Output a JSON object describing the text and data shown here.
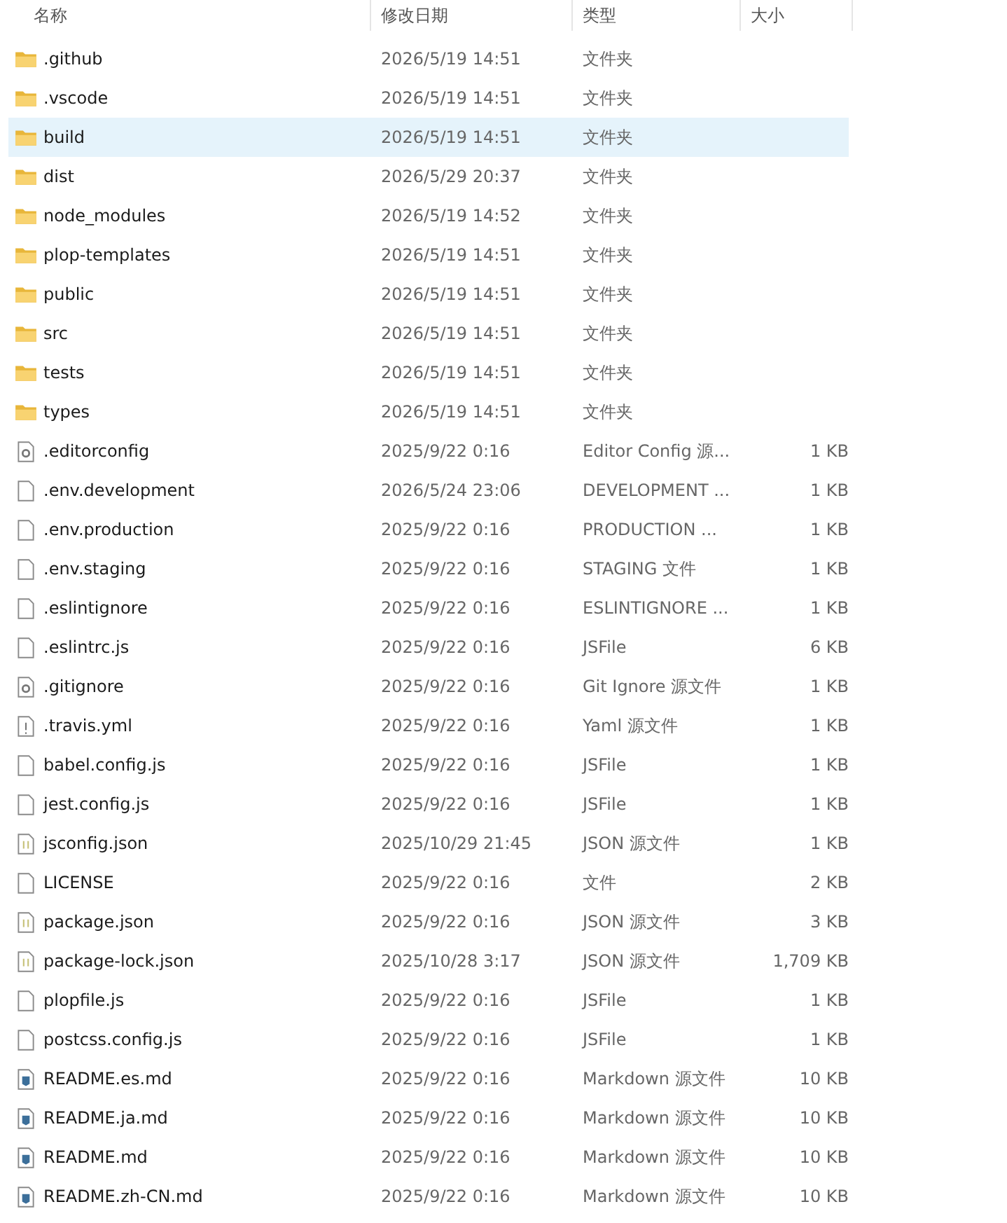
{
  "columns": [
    "名称",
    "修改日期",
    "类型",
    "大小"
  ],
  "rows": [
    {
      "kind": "folder",
      "name": ".github",
      "date": "2026/5/19 14:51",
      "type": "文件夹",
      "selected": false
    },
    {
      "kind": "folder",
      "name": ".vscode",
      "date": "2026/5/19 14:51",
      "type": "文件夹",
      "selected": false
    },
    {
      "kind": "folder",
      "name": "build",
      "date": "2026/5/19 14:51",
      "type": "文件夹",
      "selected": true
    },
    {
      "kind": "folder",
      "name": "dist",
      "date": "2026/5/29 20:37",
      "type": "文件夹",
      "selected": false
    },
    {
      "kind": "folder",
      "name": "node_modules",
      "date": "2026/5/19 14:52",
      "type": "文件夹",
      "selected": false
    },
    {
      "kind": "folder",
      "name": "plop-templates",
      "date": "2026/5/19 14:51",
      "type": "文件夹",
      "selected": false
    },
    {
      "kind": "folder",
      "name": "public",
      "date": "2026/5/19 14:51",
      "type": "文件夹",
      "selected": false
    },
    {
      "kind": "folder",
      "name": "src",
      "date": "2026/5/19 14:51",
      "type": "文件夹",
      "selected": false
    },
    {
      "kind": "folder",
      "name": "tests",
      "date": "2026/5/19 14:51",
      "type": "文件夹",
      "selected": false
    },
    {
      "kind": "folder",
      "name": "types",
      "date": "2026/5/19 14:51",
      "type": "文件夹",
      "selected": false
    },
    {
      "kind": "settings",
      "name": ".editorconfig",
      "date": "2025/9/22 0:16",
      "type": "Editor Config 源...",
      "size": "1 KB",
      "selected": false
    },
    {
      "kind": "file",
      "name": ".env.development",
      "date": "2026/5/24 23:06",
      "type": "DEVELOPMENT ...",
      "size": "1 KB",
      "selected": false
    },
    {
      "kind": "file",
      "name": ".env.production",
      "date": "2025/9/22 0:16",
      "type": "PRODUCTION ...",
      "size": "1 KB",
      "selected": false
    },
    {
      "kind": "file",
      "name": ".env.staging",
      "date": "2025/9/22 0:16",
      "type": "STAGING 文件",
      "size": "1 KB",
      "selected": false
    },
    {
      "kind": "file",
      "name": ".eslintignore",
      "date": "2025/9/22 0:16",
      "type": "ESLINTIGNORE ...",
      "size": "1 KB",
      "selected": false
    },
    {
      "kind": "file",
      "name": ".eslintrc.js",
      "date": "2025/9/22 0:16",
      "type": "JSFile",
      "size": "6 KB",
      "selected": false
    },
    {
      "kind": "settings",
      "name": ".gitignore",
      "date": "2025/9/22 0:16",
      "type": "Git Ignore 源文件",
      "size": "1 KB",
      "selected": false
    },
    {
      "kind": "yaml",
      "name": ".travis.yml",
      "date": "2025/9/22 0:16",
      "type": "Yaml 源文件",
      "size": "1 KB",
      "selected": false
    },
    {
      "kind": "file",
      "name": "babel.config.js",
      "date": "2025/9/22 0:16",
      "type": "JSFile",
      "size": "1 KB",
      "selected": false
    },
    {
      "kind": "file",
      "name": "jest.config.js",
      "date": "2025/9/22 0:16",
      "type": "JSFile",
      "size": "1 KB",
      "selected": false
    },
    {
      "kind": "json",
      "name": "jsconfig.json",
      "date": "2025/10/29 21:45",
      "type": "JSON 源文件",
      "size": "1 KB",
      "selected": false
    },
    {
      "kind": "file",
      "name": "LICENSE",
      "date": "2025/9/22 0:16",
      "type": "文件",
      "size": "2 KB",
      "selected": false
    },
    {
      "kind": "json",
      "name": "package.json",
      "date": "2025/9/22 0:16",
      "type": "JSON 源文件",
      "size": "3 KB",
      "selected": false
    },
    {
      "kind": "json",
      "name": "package-lock.json",
      "date": "2025/10/28 3:17",
      "type": "JSON 源文件",
      "size": "1,709 KB",
      "selected": false
    },
    {
      "kind": "file",
      "name": "plopfile.js",
      "date": "2025/9/22 0:16",
      "type": "JSFile",
      "size": "1 KB",
      "selected": false
    },
    {
      "kind": "file",
      "name": "postcss.config.js",
      "date": "2025/9/22 0:16",
      "type": "JSFile",
      "size": "1 KB",
      "selected": false
    },
    {
      "kind": "markdown",
      "name": "README.es.md",
      "date": "2025/9/22 0:16",
      "type": "Markdown 源文件",
      "size": "10 KB",
      "selected": false
    },
    {
      "kind": "markdown",
      "name": "README.ja.md",
      "date": "2025/9/22 0:16",
      "type": "Markdown 源文件",
      "size": "10 KB",
      "selected": false
    },
    {
      "kind": "markdown",
      "name": "README.md",
      "date": "2025/9/22 0:16",
      "type": "Markdown 源文件",
      "size": "10 KB",
      "selected": false
    },
    {
      "kind": "markdown",
      "name": "README.zh-CN.md",
      "date": "2025/9/22 0:16",
      "type": "Markdown 源文件",
      "size": "10 KB",
      "selected": false
    }
  ]
}
